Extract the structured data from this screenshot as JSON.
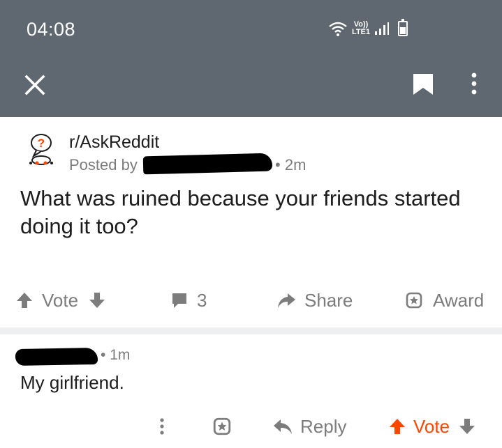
{
  "status_bar": {
    "time": "04:08",
    "network_label_top": "Vo))",
    "network_label_bottom": "LTE1"
  },
  "top_bar": {
    "close_icon": "close-icon",
    "bookmark_icon": "bookmark-icon",
    "more_icon": "more-vertical-icon"
  },
  "post": {
    "subreddit": "r/AskReddit",
    "posted_by_prefix": "Posted by",
    "age": "2m",
    "title": "What was ruined because your friends started doing it too?",
    "actions": {
      "vote_label": "Vote",
      "comment_count": "3",
      "share_label": "Share",
      "award_label": "Award"
    }
  },
  "comment": {
    "age": "1m",
    "text": "My girlfriend.",
    "actions": {
      "reply_label": "Reply",
      "vote_label": "Vote"
    }
  },
  "colors": {
    "header_bg": "#5f6870",
    "muted_text": "#7c7c7c",
    "upvote_accent": "#ff4500",
    "divider": "#edeff1"
  }
}
